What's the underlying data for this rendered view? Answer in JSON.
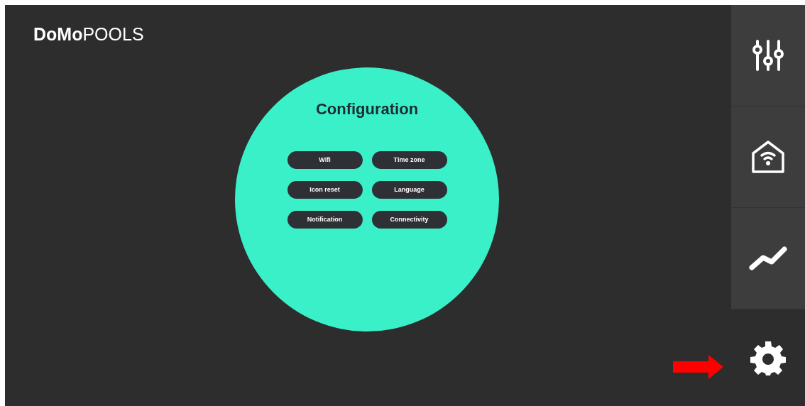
{
  "header": {
    "logo_bold": "DoMo",
    "logo_light": "POOLS"
  },
  "panel": {
    "title": "Configuration",
    "buttons": [
      "Wifi",
      "Time zone",
      "Icon reset",
      "Language",
      "Notification",
      "Connectivity"
    ]
  },
  "sidebar": {
    "items": [
      {
        "kind": "sliders",
        "selected": false
      },
      {
        "kind": "smart-home",
        "selected": false
      },
      {
        "kind": "chart",
        "selected": false
      },
      {
        "kind": "settings",
        "selected": true
      }
    ]
  },
  "annotation": {
    "kind": "arrow"
  }
}
